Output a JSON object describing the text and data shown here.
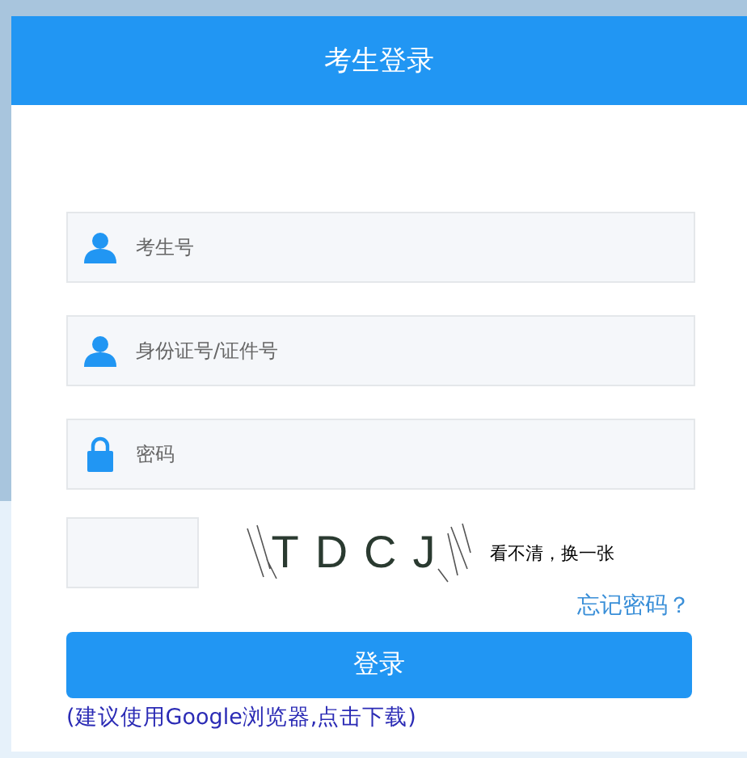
{
  "header": {
    "title": "考生登录"
  },
  "fields": [
    {
      "kind": "user",
      "placeholder": "考生号"
    },
    {
      "kind": "user",
      "placeholder": "身份证号/证件号"
    },
    {
      "kind": "lock",
      "placeholder": "密码"
    }
  ],
  "captcha": {
    "code": "TDCJ",
    "refresh": "看不清，换一张"
  },
  "forgot": "忘记密码？",
  "submit": "登录",
  "download_link": "(建议使用Google浏览器,点击下载)"
}
